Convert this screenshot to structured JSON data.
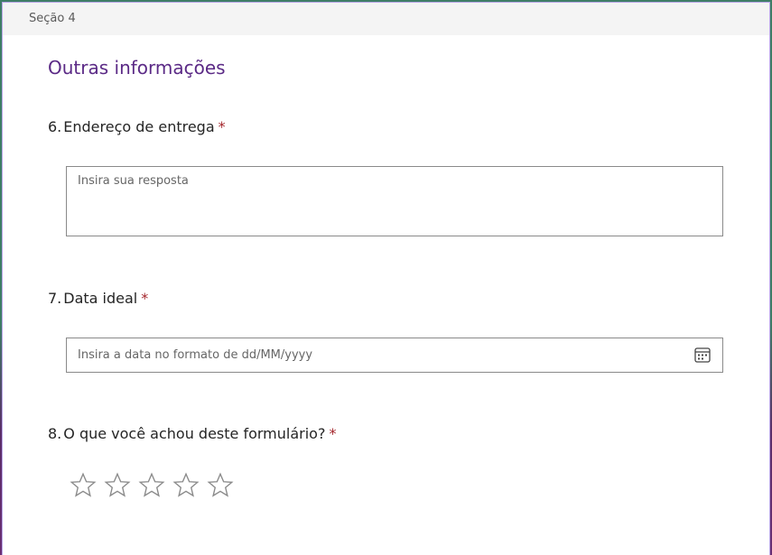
{
  "section": {
    "label": "Seção 4",
    "title": "Outras informações"
  },
  "required_mark": "*",
  "questions": [
    {
      "number": "6.",
      "text": "Endereço de entrega",
      "placeholder": "Insira sua resposta"
    },
    {
      "number": "7.",
      "text": "Data ideal",
      "placeholder": "Insira a data no formato de dd/MM/yyyy"
    },
    {
      "number": "8.",
      "text": "O que você achou deste formulário?",
      "rating_max": 5,
      "rating_value": 0
    }
  ],
  "colors": {
    "title": "#5b2a86",
    "required": "#a4262c"
  },
  "icons": {
    "date": "calendar-icon",
    "rating": "star-outline-icon"
  }
}
